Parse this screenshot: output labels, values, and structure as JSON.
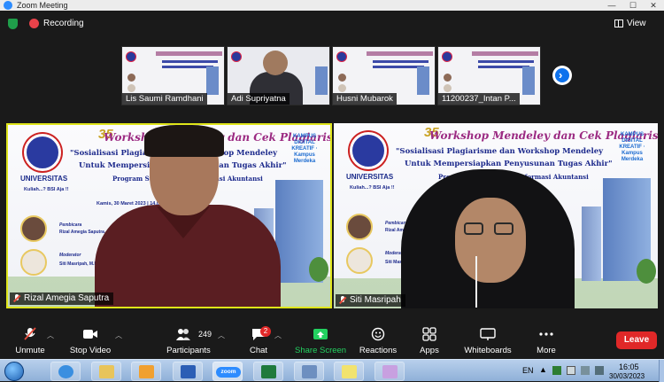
{
  "window": {
    "title": "Zoom Meeting",
    "minimize": "—",
    "maximize": "☐",
    "close": "✕"
  },
  "topbar": {
    "recording_label": "Recording",
    "view_label": "View"
  },
  "thumbnails": [
    {
      "name": "Lis Saumi Ramdhani",
      "kind": "slide"
    },
    {
      "name": "Adi Supriyatna",
      "kind": "camera"
    },
    {
      "name": "Husni Mubarok",
      "kind": "slide"
    },
    {
      "name": "11200237_Intan P...",
      "kind": "slide"
    }
  ],
  "next_arrow": "›",
  "tiles": {
    "left": {
      "name": "Rizal Amegia Saputra"
    },
    "right": {
      "name": "Siti Masripah"
    }
  },
  "slide": {
    "badge": "35",
    "workshop": "Workshop Mendeley dan Cek Plagiarisme",
    "line1": "\"Sosialisasi Plagiarisme dan Workshop Mendeley",
    "line2": "Untuk Mempersiapkan Penyusunan Tugas Akhir\"",
    "line3": "Program Studi Sistem Informasi Akuntansi",
    "uni": "UNIVERSITAS",
    "kampus": "KAMPUS DIGITAL KREATIF · Kampus Merdeka",
    "kuliah": "Kuliah...? BSI Aja !!",
    "date": "Kamis, 30 Maret 2023 | 14.00 WIB",
    "speaker_label": "Pembicara",
    "speaker_name": "Rizal Amegia Saputra, M.Kom",
    "moderator_label": "Moderator",
    "moderator_name": "Siti Masripah, M.Kom"
  },
  "controls": {
    "unmute": "Unmute",
    "stop_video": "Stop Video",
    "participants": "Participants",
    "participants_count": "249",
    "chat": "Chat",
    "chat_badge": "2",
    "share_screen": "Share Screen",
    "reactions": "Reactions",
    "apps": "Apps",
    "whiteboards": "Whiteboards",
    "more": "More",
    "leave": "Leave"
  },
  "taskbar": {
    "language": "EN",
    "time": "16:05",
    "date": "30/03/2023",
    "zoom_label": "zoom"
  }
}
